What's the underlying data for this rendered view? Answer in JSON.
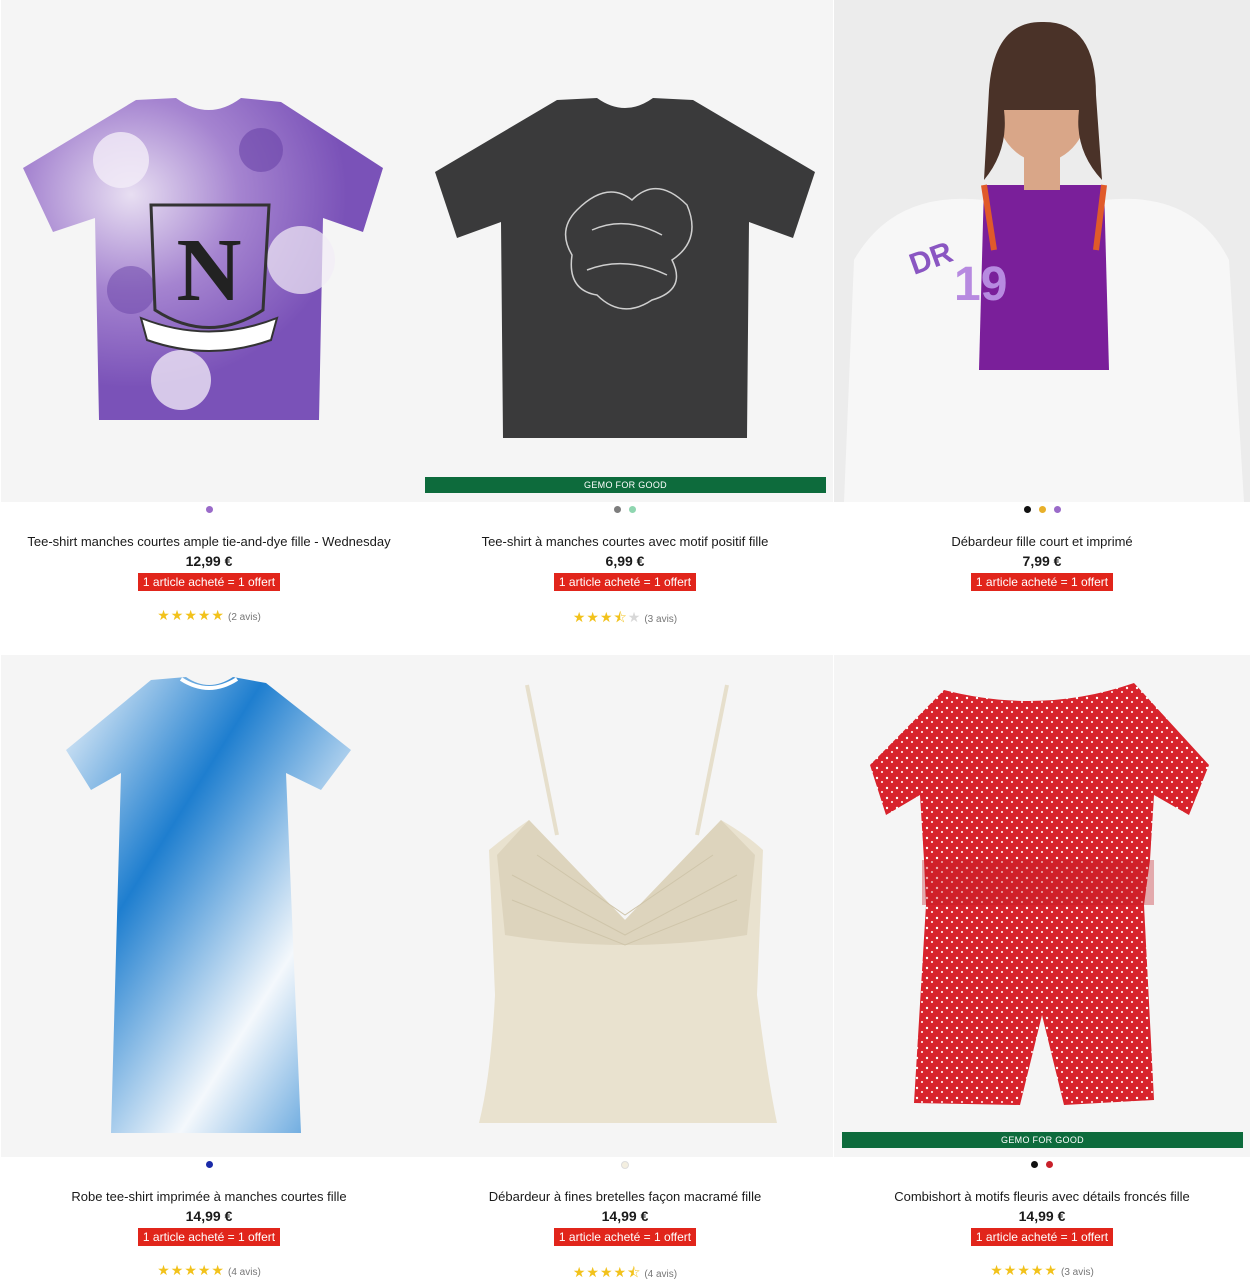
{
  "colors": {
    "badge_green": "#0d6b3c",
    "promo_red": "#e1251b",
    "star_gold": "#f2c21b"
  },
  "products": [
    {
      "title": "Tee-shirt manches courtes ample tie-and-dye fille - Wednesday",
      "price": "12,99 €",
      "promo": "1 article acheté = 1 offert",
      "rating": 5,
      "reviews": "(2 avis)",
      "badge": "",
      "swatches": [
        "#9a6bc9"
      ],
      "image": "purple-tie-dye-tshirt"
    },
    {
      "title": "Tee-shirt à manches courtes avec motif positif fille",
      "price": "6,99 €",
      "promo": "1 article acheté = 1 offert",
      "rating": 3.5,
      "reviews": "(3 avis)",
      "badge": "GEMO FOR GOOD",
      "swatches": [
        "#7d7d7d",
        "#8fd6b0"
      ],
      "image": "charcoal-graphic-tshirt"
    },
    {
      "title": "Débardeur fille court et imprimé",
      "price": "7,99 €",
      "promo": "1 article acheté = 1 offert",
      "rating": 0,
      "reviews": "",
      "badge": "",
      "swatches": [
        "#111111",
        "#e8b02a",
        "#9a6bc9"
      ],
      "image": "model-purple-tank-top"
    },
    {
      "title": "Robe tee-shirt imprimée à manches courtes fille",
      "price": "14,99 €",
      "promo": "1 article acheté = 1 offert",
      "rating": 5,
      "reviews": "(4 avis)",
      "badge": "",
      "swatches": [
        "#1a2aa8"
      ],
      "image": "blue-gradient-tshirt-dress"
    },
    {
      "title": "Débardeur à fines bretelles façon macramé fille",
      "price": "14,99 €",
      "promo": "1 article acheté = 1 offert",
      "rating": 4.5,
      "reviews": "(4 avis)",
      "badge": "",
      "swatches": [
        "#f4efe0"
      ],
      "image": "cream-macrame-camisole"
    },
    {
      "title": "Combishort à motifs fleuris avec détails froncés fille",
      "price": "14,99 €",
      "promo": "1 article acheté = 1 offert",
      "rating": 5,
      "reviews": "(3 avis)",
      "badge": "GEMO FOR GOOD",
      "swatches": [
        "#111111",
        "#c8202a"
      ],
      "image": "red-floral-playsuit"
    }
  ]
}
